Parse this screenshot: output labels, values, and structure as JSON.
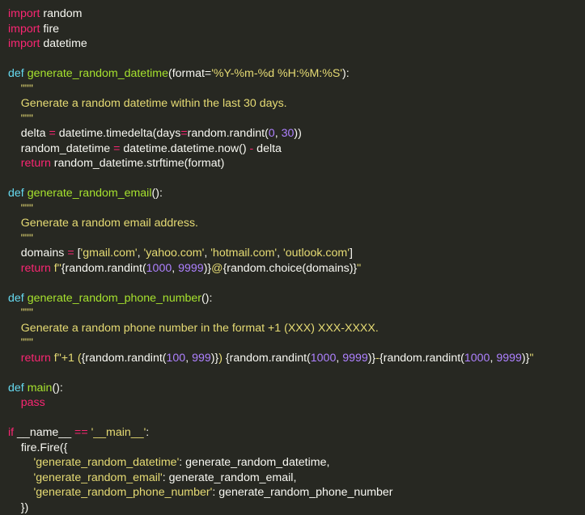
{
  "editor": {
    "background": "#272822",
    "token_colors": {
      "kw": "#f92672",
      "def": "#66d9ef",
      "fn": "#a6e22e",
      "str": "#e6db74",
      "num": "#ae81ff",
      "op": "#f92672",
      "plain": "#f8f8f2"
    },
    "lines": [
      [
        [
          "kw",
          "import"
        ],
        [
          "plain",
          " random"
        ]
      ],
      [
        [
          "kw",
          "import"
        ],
        [
          "plain",
          " fire"
        ]
      ],
      [
        [
          "kw",
          "import"
        ],
        [
          "plain",
          " datetime"
        ]
      ],
      [],
      [
        [
          "def",
          "def"
        ],
        [
          "plain",
          " "
        ],
        [
          "fn",
          "generate_random_datetime"
        ],
        [
          "plain",
          "(format="
        ],
        [
          "str",
          "'%Y-%m-%d %H:%M:%S'"
        ],
        [
          "plain",
          "):"
        ]
      ],
      [
        [
          "str",
          "    \"\"\""
        ]
      ],
      [
        [
          "str",
          "    Generate a random datetime within the last 30 days."
        ]
      ],
      [
        [
          "str",
          "    \"\"\""
        ]
      ],
      [
        [
          "plain",
          "    delta "
        ],
        [
          "op",
          "="
        ],
        [
          "plain",
          " datetime.timedelta(days"
        ],
        [
          "op",
          "="
        ],
        [
          "plain",
          "random.randint("
        ],
        [
          "num",
          "0"
        ],
        [
          "plain",
          ", "
        ],
        [
          "num",
          "30"
        ],
        [
          "plain",
          "))"
        ]
      ],
      [
        [
          "plain",
          "    random_datetime "
        ],
        [
          "op",
          "="
        ],
        [
          "plain",
          " datetime.datetime.now() "
        ],
        [
          "op",
          "-"
        ],
        [
          "plain",
          " delta"
        ]
      ],
      [
        [
          "plain",
          "    "
        ],
        [
          "kw",
          "return"
        ],
        [
          "plain",
          " random_datetime.strftime(format)"
        ]
      ],
      [],
      [
        [
          "def",
          "def"
        ],
        [
          "plain",
          " "
        ],
        [
          "fn",
          "generate_random_email"
        ],
        [
          "plain",
          "():"
        ]
      ],
      [
        [
          "str",
          "    \"\"\""
        ]
      ],
      [
        [
          "str",
          "    Generate a random email address."
        ]
      ],
      [
        [
          "str",
          "    \"\"\""
        ]
      ],
      [
        [
          "plain",
          "    domains "
        ],
        [
          "op",
          "="
        ],
        [
          "plain",
          " ["
        ],
        [
          "str",
          "'gmail.com'"
        ],
        [
          "plain",
          ", "
        ],
        [
          "str",
          "'yahoo.com'"
        ],
        [
          "plain",
          ", "
        ],
        [
          "str",
          "'hotmail.com'"
        ],
        [
          "plain",
          ", "
        ],
        [
          "str",
          "'outlook.com'"
        ],
        [
          "plain",
          "]"
        ]
      ],
      [
        [
          "plain",
          "    "
        ],
        [
          "kw",
          "return"
        ],
        [
          "plain",
          " "
        ],
        [
          "str",
          "f\""
        ],
        [
          "plain",
          "{random.randint("
        ],
        [
          "num",
          "1000"
        ],
        [
          "plain",
          ", "
        ],
        [
          "num",
          "9999"
        ],
        [
          "plain",
          ")}"
        ],
        [
          "str",
          "@"
        ],
        [
          "plain",
          "{random.choice(domains)}"
        ],
        [
          "str",
          "\""
        ]
      ],
      [],
      [
        [
          "def",
          "def"
        ],
        [
          "plain",
          " "
        ],
        [
          "fn",
          "generate_random_phone_number"
        ],
        [
          "plain",
          "():"
        ]
      ],
      [
        [
          "str",
          "    \"\"\""
        ]
      ],
      [
        [
          "str",
          "    Generate a random phone number in the format +1 (XXX) XXX-XXXX."
        ]
      ],
      [
        [
          "str",
          "    \"\"\""
        ]
      ],
      [
        [
          "plain",
          "    "
        ],
        [
          "kw",
          "return"
        ],
        [
          "plain",
          " "
        ],
        [
          "str",
          "f\"+1 ("
        ],
        [
          "plain",
          "{random.randint("
        ],
        [
          "num",
          "100"
        ],
        [
          "plain",
          ", "
        ],
        [
          "num",
          "999"
        ],
        [
          "plain",
          ")}"
        ],
        [
          "str",
          ") "
        ],
        [
          "plain",
          "{random.randint("
        ],
        [
          "num",
          "1000"
        ],
        [
          "plain",
          ", "
        ],
        [
          "num",
          "9999"
        ],
        [
          "plain",
          ")}"
        ],
        [
          "str",
          "-"
        ],
        [
          "plain",
          "{random.randint("
        ],
        [
          "num",
          "1000"
        ],
        [
          "plain",
          ", "
        ],
        [
          "num",
          "9999"
        ],
        [
          "plain",
          ")}"
        ],
        [
          "str",
          "\""
        ]
      ],
      [],
      [
        [
          "def",
          "def"
        ],
        [
          "plain",
          " "
        ],
        [
          "fn",
          "main"
        ],
        [
          "plain",
          "():"
        ]
      ],
      [
        [
          "plain",
          "    "
        ],
        [
          "kw",
          "pass"
        ]
      ],
      [],
      [
        [
          "kw",
          "if"
        ],
        [
          "plain",
          " __name__ "
        ],
        [
          "op",
          "=="
        ],
        [
          "plain",
          " "
        ],
        [
          "str",
          "'__main__'"
        ],
        [
          "plain",
          ":"
        ]
      ],
      [
        [
          "plain",
          "    fire.Fire({"
        ]
      ],
      [
        [
          "plain",
          "        "
        ],
        [
          "str",
          "'generate_random_datetime'"
        ],
        [
          "plain",
          ": generate_random_datetime,"
        ]
      ],
      [
        [
          "plain",
          "        "
        ],
        [
          "str",
          "'generate_random_email'"
        ],
        [
          "plain",
          ": generate_random_email,"
        ]
      ],
      [
        [
          "plain",
          "        "
        ],
        [
          "str",
          "'generate_random_phone_number'"
        ],
        [
          "plain",
          ": generate_random_phone_number"
        ]
      ],
      [
        [
          "plain",
          "    })"
        ]
      ]
    ]
  }
}
